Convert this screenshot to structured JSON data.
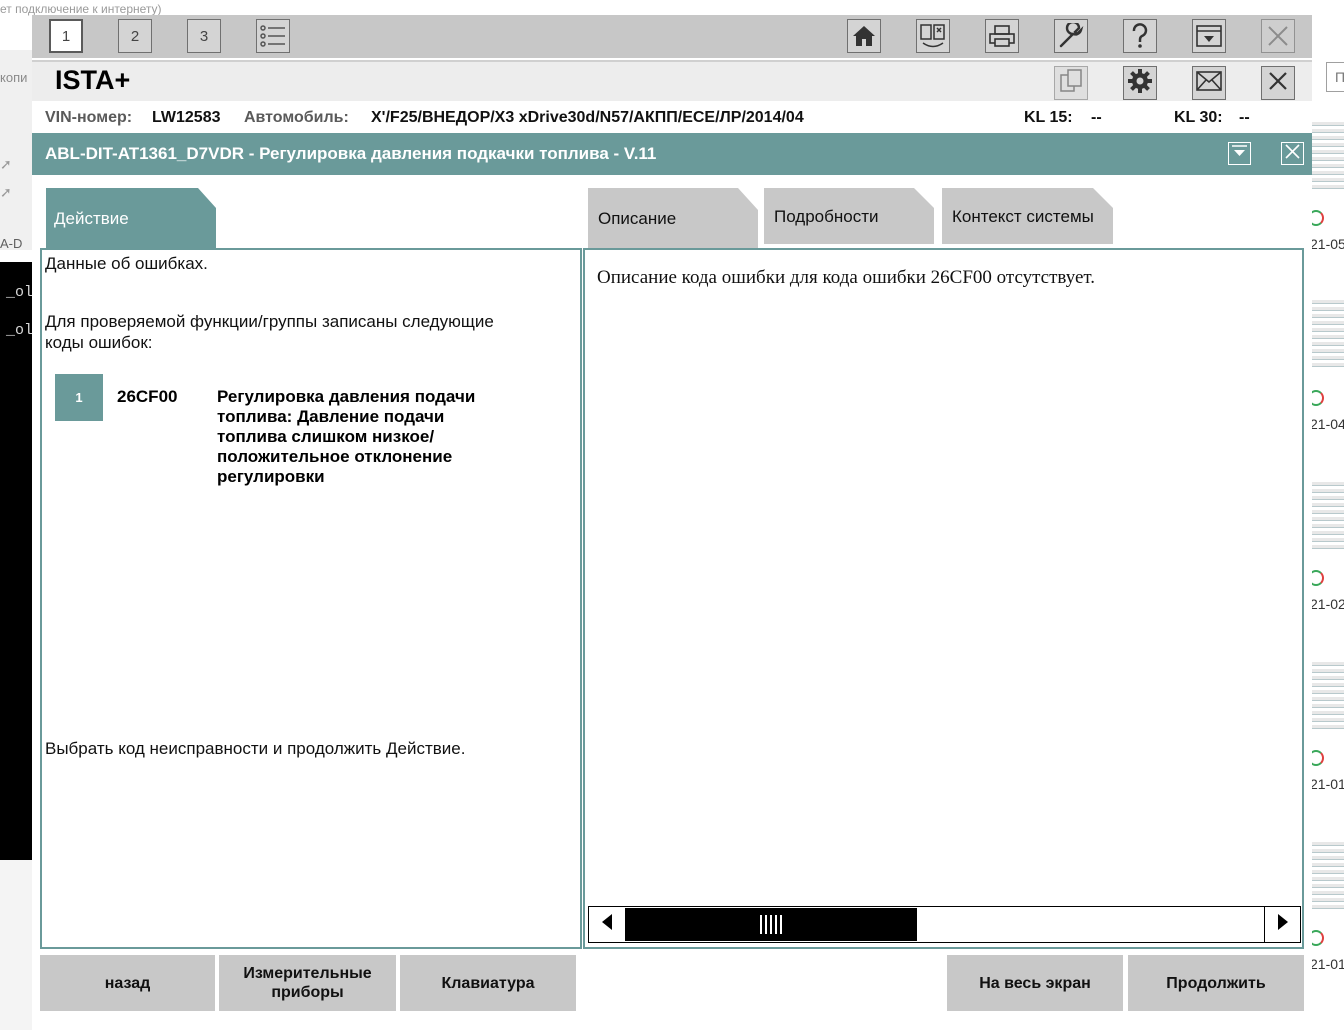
{
  "background": {
    "top_text": "ет подключение к интернету)",
    "left_text1": "копи",
    "left_text2": "A-D",
    "console_lines": [
      "_old",
      "_old"
    ],
    "right_input": "П",
    "thumbnail_labels": [
      "21-05",
      "21-04",
      "21-02",
      "21-01",
      "21-01"
    ]
  },
  "toolbar": {
    "screen_tabs": [
      "1",
      "2",
      "3"
    ],
    "icons": [
      "list-icon",
      "home-icon",
      "vehicle-management-icon",
      "print-icon",
      "service-wrench-icon",
      "help-icon",
      "minimize-icon",
      "close-icon"
    ]
  },
  "app": {
    "name": "ISTA+"
  },
  "vehicle": {
    "vin_label": "VIN-номер:",
    "vin_value": "LW12583",
    "car_label": "Автомобиль:",
    "car_value": "X'/F25/ВНЕДОР/X3 xDrive30d/N57/АКПП/ECE/ЛР/2014/04",
    "kl15_label": "KL 15:",
    "kl15_value": "--",
    "kl30_label": "KL 30:",
    "kl30_value": "--"
  },
  "header": {
    "title": "ABL-DIT-AT1361_D7VDR - Регулировка давления подкачки топлива - V.11"
  },
  "tabs": {
    "action": "Действие",
    "description": "Описание",
    "details": "Подробности",
    "system_context": "Контекст системы"
  },
  "left_panel": {
    "heading": "Данные об ошибках.",
    "intro": "Для проверяемой функции/группы записаны следующие коды ошибок:",
    "faults": [
      {
        "number": "1",
        "code": "26CF00",
        "description": "Регулировка давления подачи топлива: Давление подачи топлива слишком низкое/ положительное отклонение регулировки"
      }
    ],
    "instruction": "Выбрать код неисправности и продолжить Действие."
  },
  "right_panel": {
    "text": "Описание кода ошибки для кода ошибки 26CF00 отсутствует."
  },
  "bottom_buttons": {
    "back": "назад",
    "measuring": "Измерительные приборы",
    "keyboard": "Клавиатура",
    "fullscreen": "На весь экран",
    "continue": "Продолжить"
  },
  "colors": {
    "accent": "#6a9a9a",
    "toolbar_bg": "#c7c7c7",
    "button_bg": "#c8c8c8"
  }
}
